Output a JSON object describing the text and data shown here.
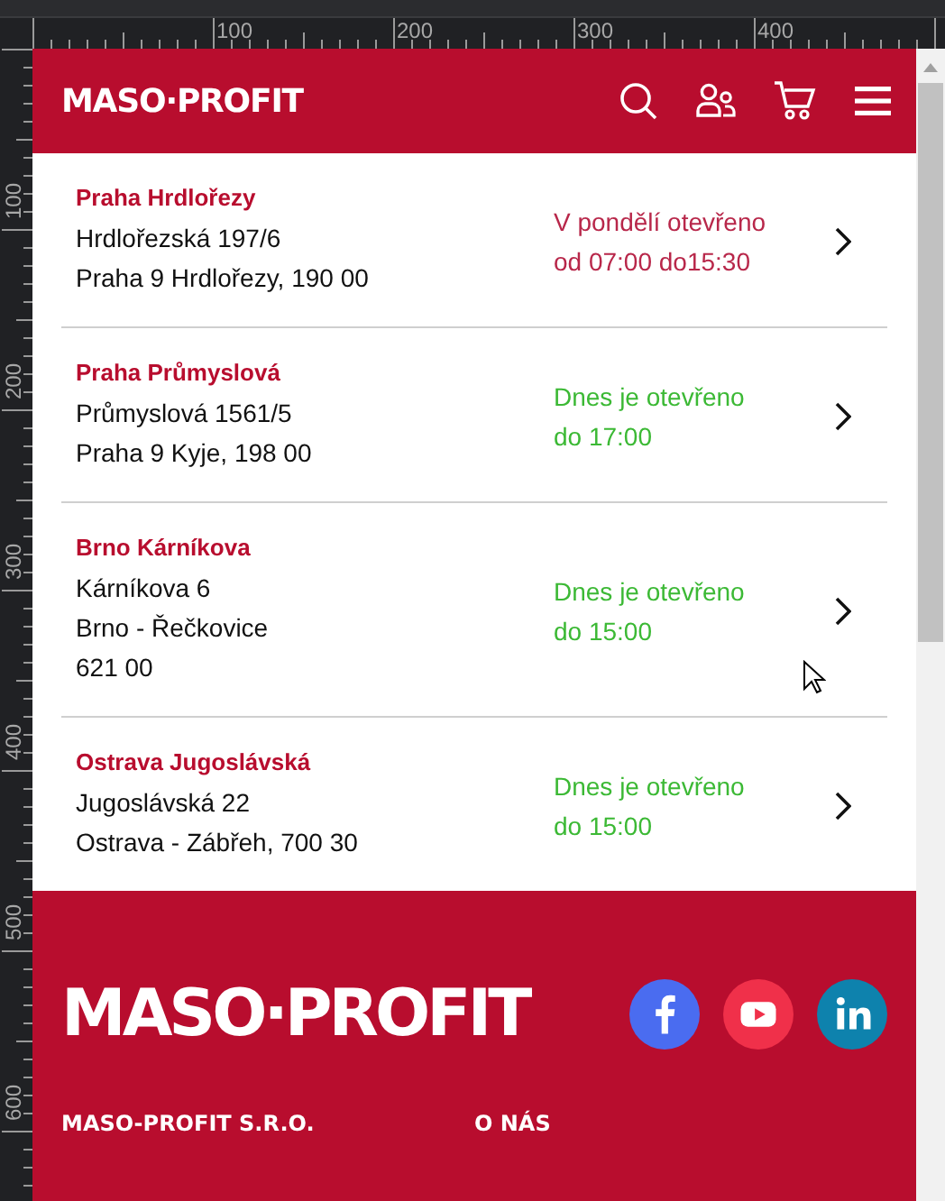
{
  "rulers": {
    "top_labels": [
      "100",
      "200",
      "300",
      "400"
    ],
    "left_labels": [
      "100",
      "200",
      "300",
      "400",
      "500",
      "600"
    ]
  },
  "header": {
    "logo": "MASO·PROFIT"
  },
  "branches": [
    {
      "name": "Praha Hrdlořezy",
      "address": [
        "Hrdlořezská 197/6",
        "Praha 9 Hrdlořezy, 190 00"
      ],
      "open_today": false,
      "hours": [
        "V pondělí otevřeno",
        "od 07:00 do15:30"
      ]
    },
    {
      "name": "Praha Průmyslová",
      "address": [
        "Průmyslová 1561/5",
        "Praha 9 Kyje, 198 00"
      ],
      "open_today": true,
      "hours": [
        "Dnes je otevřeno",
        "do 17:00"
      ]
    },
    {
      "name": "Brno Kárníkova",
      "address": [
        "Kárníkova 6",
        "Brno - Řečkovice",
        "621 00"
      ],
      "open_today": true,
      "hours": [
        "Dnes je otevřeno",
        "do 15:00"
      ]
    },
    {
      "name": "Ostrava Jugoslávská",
      "address": [
        "Jugoslávská 22",
        "Ostrava - Zábřeh, 700 30"
      ],
      "open_today": true,
      "hours": [
        "Dnes je otevřeno",
        "do 15:00"
      ]
    }
  ],
  "footer": {
    "logo": "MASO·PROFIT",
    "socials": [
      {
        "kind": "facebook",
        "color": "#4a6cf0"
      },
      {
        "kind": "youtube",
        "color": "#f0304a"
      },
      {
        "kind": "linkedin",
        "color": "#0e82ad"
      }
    ],
    "headings": [
      "MASO-PROFIT S.R.O.",
      "O NÁS"
    ]
  }
}
